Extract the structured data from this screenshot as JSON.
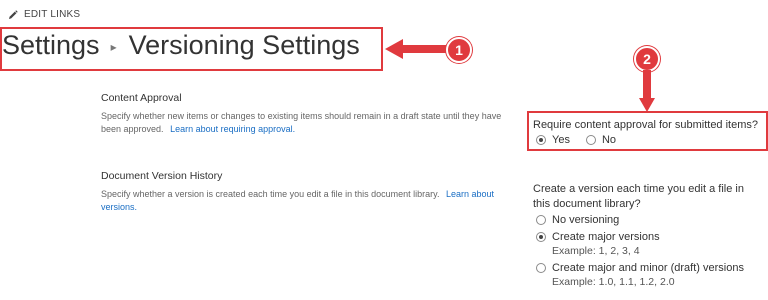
{
  "header": {
    "edit_links": "EDIT LINKS",
    "breadcrumb_root": "Settings",
    "breadcrumb_separator": "▸",
    "page_title": "Versioning Settings"
  },
  "annotations": {
    "color": "#e03a3e",
    "badge1": "1",
    "badge2": "2"
  },
  "content_approval": {
    "title": "Content Approval",
    "description": "Specify whether new items or changes to existing items should remain in a draft state until they have been approved.",
    "learn_more": "Learn about requiring approval.",
    "question": "Require content approval for submitted items?",
    "options": [
      {
        "label": "Yes",
        "checked": true
      },
      {
        "label": "No",
        "checked": false
      }
    ]
  },
  "version_history": {
    "title": "Document Version History",
    "description": "Specify whether a version is created each time you edit a file in this document library.",
    "learn_more": "Learn about versions.",
    "question": "Create a version each time you edit a file in this document library?",
    "options": [
      {
        "label": "No versioning",
        "example": "",
        "checked": false
      },
      {
        "label": "Create major versions",
        "example": "Example: 1, 2, 3, 4",
        "checked": true
      },
      {
        "label": "Create major and minor (draft) versions",
        "example": "Example: 1.0, 1.1, 1.2, 2.0",
        "checked": false
      }
    ]
  }
}
